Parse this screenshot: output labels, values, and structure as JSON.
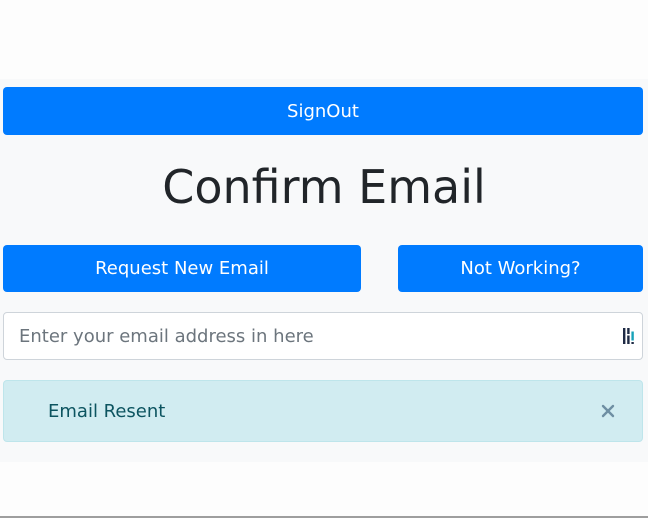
{
  "header": {
    "signout_label": "SignOut",
    "title": "Confirm Email"
  },
  "actions": {
    "request_label": "Request New Email",
    "not_working_label": "Not Working?"
  },
  "email_input": {
    "value": "",
    "placeholder": "Enter your email address in here",
    "autofill_icon": "password-manager-icon"
  },
  "alert": {
    "text": "Email Resent",
    "close_icon": "close-icon"
  },
  "colors": {
    "primary": "#007bff",
    "alert_bg": "#d1ecf1",
    "alert_text": "#0c5460",
    "title_text": "#212529"
  }
}
